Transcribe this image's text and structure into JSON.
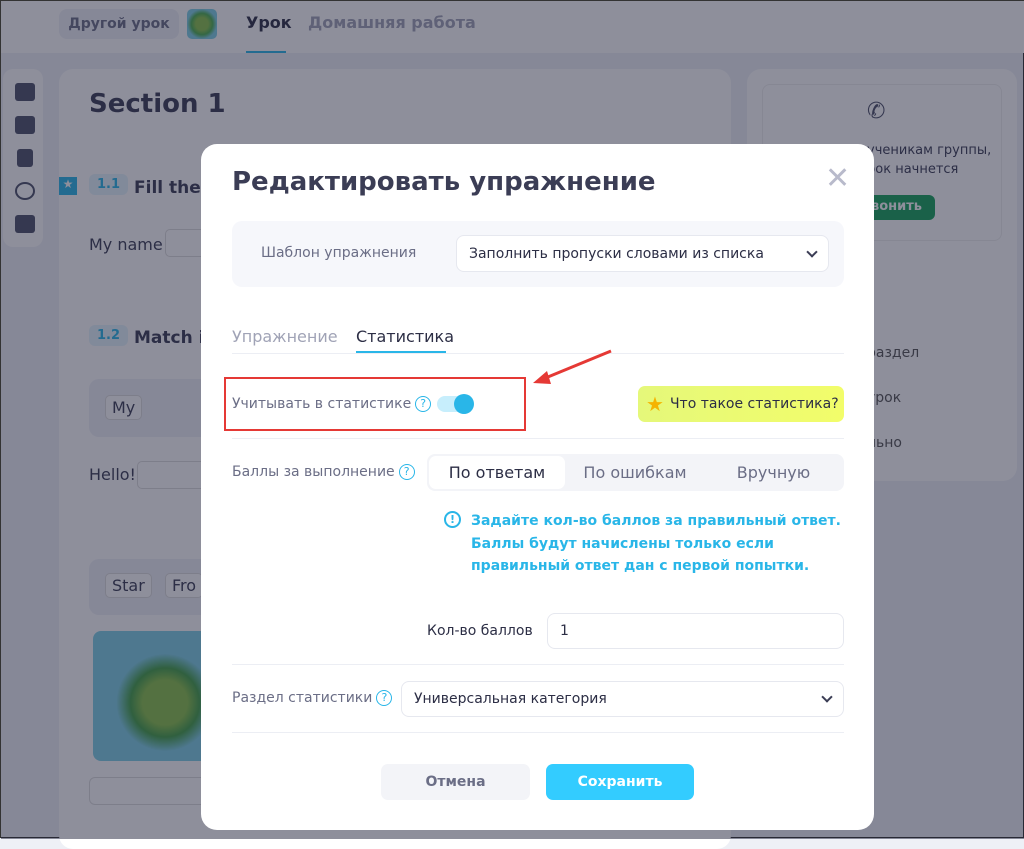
{
  "topbar": {
    "other_lesson": "Другой урок",
    "tabs": [
      "Урок",
      "Домашняя работа"
    ]
  },
  "main": {
    "section_title": "Section 1",
    "ex1_num": "1.1",
    "ex1_title": "Fill the b",
    "ex1_text": "My name",
    "ex2_num": "1.2",
    "ex2_title": "Match it",
    "word_my": "My",
    "hello": "Hello!",
    "word_star": "Star",
    "word_frog": "Fro"
  },
  "right": {
    "text1": "ученикам группы,",
    "text2": "рок начнется",
    "call_btn": "вонить",
    "menu": [
      "раздел",
      "урок",
      "льно"
    ]
  },
  "dialog": {
    "title": "Редактировать упражнение",
    "template_label": "Шаблон упражнения",
    "template_value": "Заполнить пропуски словами из списка",
    "tabs": [
      "Упражнение",
      "Статистика"
    ],
    "active_tab": "Статистика",
    "count_in_stats_label": "Учитывать в статистике",
    "count_in_stats_on": true,
    "what_is_stats": "Что такое статистика?",
    "points_label": "Баллы за выполнение",
    "points_options": [
      "По ответам",
      "По ошибкам",
      "Вручную"
    ],
    "points_selected": "По ответам",
    "info_lines": [
      "Задайте кол-во баллов за правильный ответ.",
      "Баллы будут начислены только если",
      "правильный ответ дан с первой попытки."
    ],
    "points_count_label": "Кол-во баллов",
    "points_count_value": "1",
    "stats_section_label": "Раздел статистики",
    "stats_section_value": "Универсальная категория",
    "cancel": "Отмена",
    "save": "Сохранить"
  },
  "colors": {
    "accent": "#29b6e8",
    "save": "#33ccff",
    "highlight": "#e53935",
    "yellow": "#eefc6a"
  }
}
